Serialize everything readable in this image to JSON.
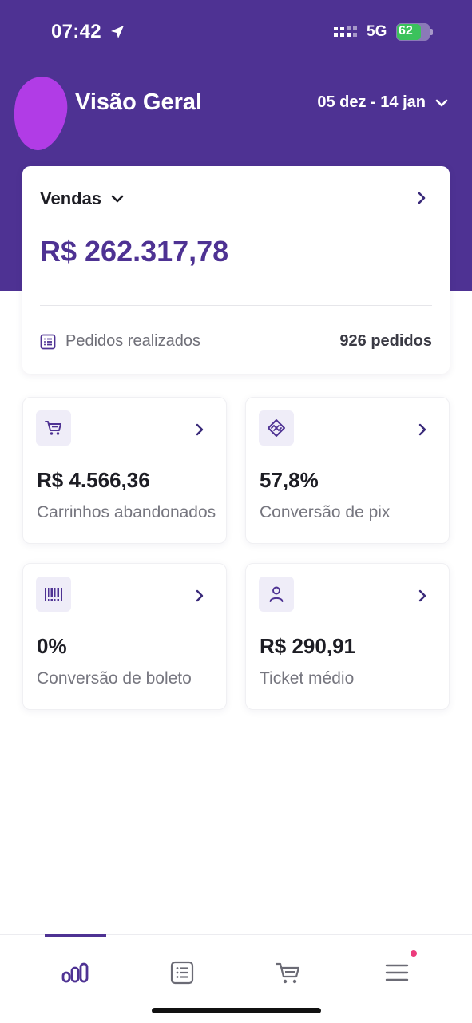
{
  "status_bar": {
    "time": "07:42",
    "network": "5G",
    "battery": "62"
  },
  "header": {
    "title": "Visão Geral",
    "date_range": "05 dez - 14 jan"
  },
  "sales_card": {
    "title": "Vendas",
    "value": "R$ 262.317,78",
    "orders_label": "Pedidos realizados",
    "orders_value": "926 pedidos"
  },
  "metrics": [
    {
      "icon": "cart-icon",
      "value": "R$ 4.566,36",
      "label": "Carrinhos abandonados"
    },
    {
      "icon": "pix-icon",
      "value": "57,8%",
      "label": "Conversão de pix"
    },
    {
      "icon": "barcode-icon",
      "value": "0%",
      "label": "Conversão de boleto"
    },
    {
      "icon": "user-icon",
      "value": "R$ 290,91",
      "label": "Ticket médio"
    }
  ],
  "nav": {
    "items": [
      "chart-icon",
      "list-icon",
      "cart-icon",
      "menu-icon"
    ],
    "active_index": 0
  },
  "colors": {
    "primary": "#4e3293",
    "avatar": "#b13ce6",
    "battery": "#3bc25c",
    "notification": "#ec3b7c"
  }
}
